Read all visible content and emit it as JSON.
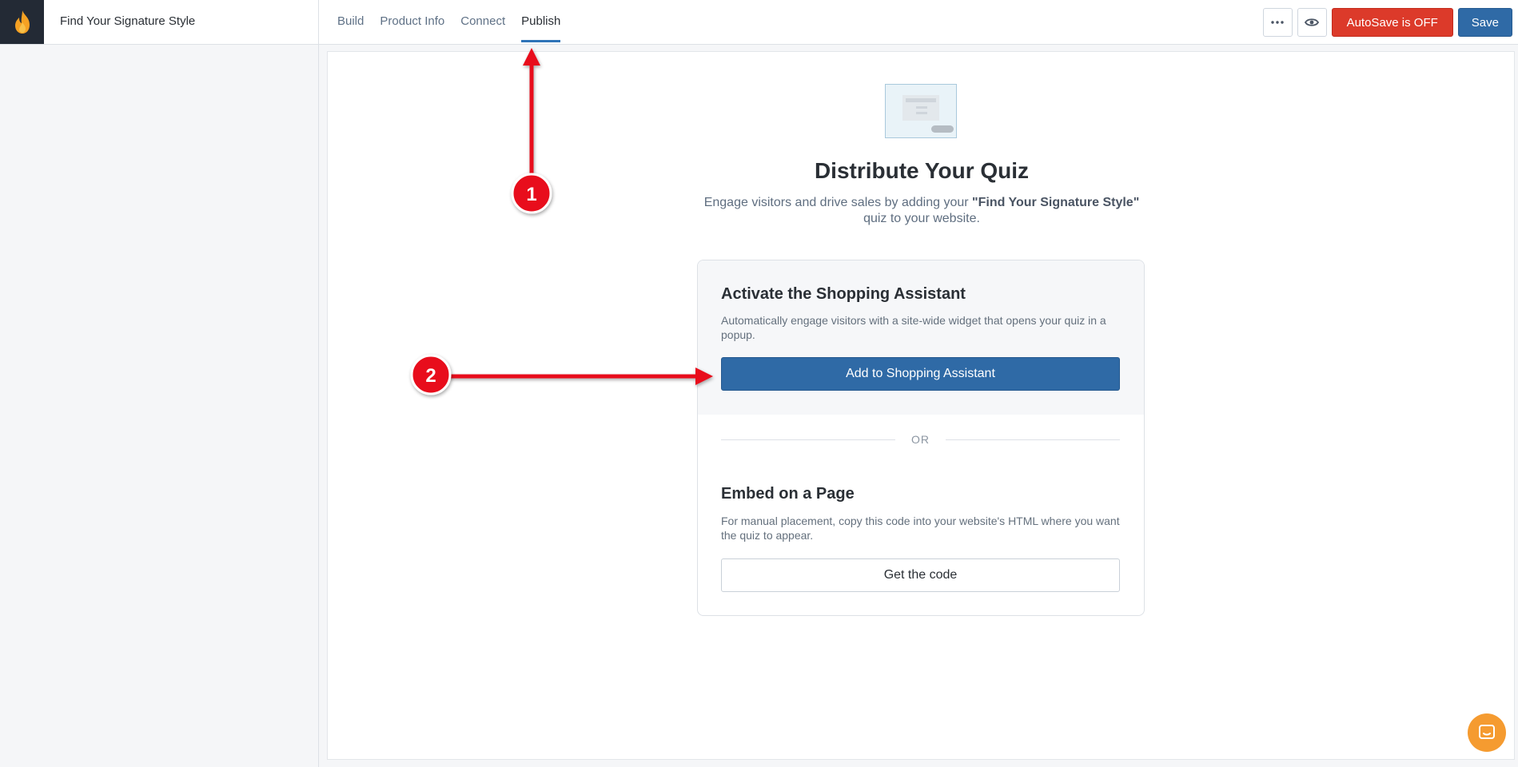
{
  "header": {
    "quiz_title": "Find Your Signature Style",
    "tabs": [
      {
        "label": "Build"
      },
      {
        "label": "Product Info"
      },
      {
        "label": "Connect"
      },
      {
        "label": "Publish",
        "active": true
      }
    ],
    "actions": {
      "more_icon": "ellipsis-icon",
      "preview_icon": "eye-icon",
      "autosave_label": "AutoSave is OFF",
      "save_label": "Save"
    }
  },
  "main": {
    "heading": "Distribute Your Quiz",
    "subtitle_pre": "Engage visitors and drive sales by adding your ",
    "subtitle_bold": "\"Find Your Signature Style\"",
    "subtitle_post": " quiz to your website.",
    "assistant": {
      "title": "Activate the Shopping Assistant",
      "description": "Automatically engage visitors with a site-wide widget that opens your quiz in a popup.",
      "button_label": "Add to Shopping Assistant"
    },
    "or_label": "OR",
    "embed": {
      "title": "Embed on a Page",
      "description": "For manual placement, copy this code into your website's HTML where you want the quiz to appear.",
      "button_label": "Get the code"
    }
  },
  "annotations": {
    "badge_1": "1",
    "badge_2": "2",
    "color": "#e8111b"
  },
  "colors": {
    "primary": "#2f6aa6",
    "danger": "#dc3a2a",
    "brand_dark": "#232a35",
    "chat": "#f59b30"
  }
}
